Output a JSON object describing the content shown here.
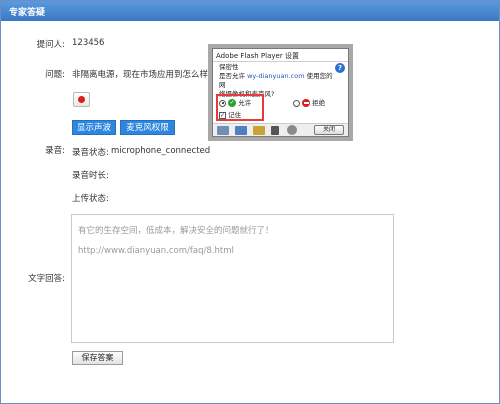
{
  "window": {
    "title": "专家答疑"
  },
  "form": {
    "asker_label": "提问人:",
    "asker_value": "123456",
    "question_label": "问题:",
    "question_value": "非隔离电源，现在市场应用到怎么样？谁",
    "show_wave_label": "显示声波",
    "mic_permission_label": "麦克风权限",
    "recording_label": "录音:",
    "recording_status_label": "录音状态:",
    "recording_status_value": "microphone_connected",
    "recording_duration_label": "录音时长:",
    "upload_status_label": "上传状态:",
    "text_answer_label": "文字回答:",
    "answer_lines": [
      "有它的生存空间，低成本，解决安全的问题就行了！",
      "http://www.dianyuan.com/faq/8.html"
    ],
    "save_label": "保存答案"
  },
  "flash_dialog": {
    "title": "Adobe Flash Player 设置",
    "message_prefix": "保密性",
    "message_line2_pre": "是否允许 ",
    "message_site": "wy-dianyuan.com",
    "message_line2_post": " 使用您的网",
    "message_line3": "络摄像机和麦克风?",
    "allow_label": "允许",
    "deny_label": "拒绝",
    "remember_label": "记住",
    "close_label": "关闭",
    "help_glyph": "?"
  },
  "colors": {
    "title_bar": "#3a78c6",
    "button_blue": "#2f86de",
    "highlight_red": "#e53b3b",
    "record_dot": "#e01b1b"
  },
  "icons": [
    "record-icon",
    "help-icon",
    "allow-check-icon",
    "deny-icon",
    "privacy-icon",
    "display-icon",
    "storage-icon",
    "microphone-icon",
    "camera-icon"
  ]
}
